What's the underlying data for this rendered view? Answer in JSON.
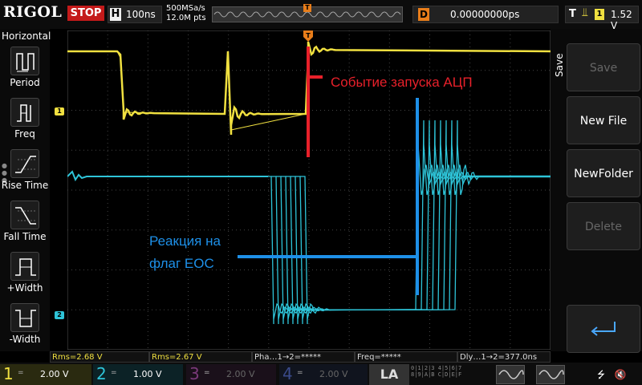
{
  "brand": "RIGOL",
  "run_state": "STOP",
  "horizontal": {
    "label": "H",
    "timebase": "100ns"
  },
  "sampling": {
    "rate": "500MSa/s",
    "points": "12.0M pts"
  },
  "trigger_pos_marker": "T",
  "delay": {
    "label": "D",
    "value": "0.00000000ps"
  },
  "trigger": {
    "label": "T",
    "slope_icon": "rising-edge-icon",
    "source": "1",
    "level": "1.52 V"
  },
  "left_menu": {
    "title": "Horizontal",
    "items": [
      {
        "label": "Period",
        "icon": "period-icon"
      },
      {
        "label": "Freq",
        "icon": "freq-icon"
      },
      {
        "label": "Rise Time",
        "icon": "rise-time-icon"
      },
      {
        "label": "Fall Time",
        "icon": "fall-time-icon"
      },
      {
        "label": "+Width",
        "icon": "pos-width-icon"
      },
      {
        "label": "-Width",
        "icon": "neg-width-icon"
      }
    ]
  },
  "channel_markers": {
    "ch1": "1",
    "ch2": "2"
  },
  "annotations": {
    "adc_trigger": "Событие запуска АЦП",
    "eoc_line1": "Реакция  на",
    "eoc_line2": "флаг EOC"
  },
  "right_menu": {
    "title": "Save",
    "buttons": [
      {
        "label": "Save",
        "enabled": false
      },
      {
        "label": "New File",
        "enabled": true
      },
      {
        "label": "NewFolder",
        "enabled": true
      },
      {
        "label": "Delete",
        "enabled": false
      },
      {
        "label": "",
        "icon": "return-icon",
        "enabled": true
      }
    ]
  },
  "measurements": [
    {
      "text": "Rms=2.68 V",
      "color": "#f0e040"
    },
    {
      "text": "Rms=2.67 V",
      "color": "#f0e040"
    },
    {
      "text": "Pha…1→2=*****",
      "color": "#dddddd"
    },
    {
      "text": "Freq=*****",
      "color": "#dddddd"
    },
    {
      "text": "Dly…1→2=377.0ns",
      "color": "#dddddd"
    }
  ],
  "channels": [
    {
      "num": "1",
      "coupling": "=",
      "scale": "2.00 V",
      "color": "#f0e040",
      "active": true
    },
    {
      "num": "2",
      "coupling": "=",
      "scale": "1.00 V",
      "color": "#2ec4d8",
      "active": true
    },
    {
      "num": "3",
      "coupling": "=",
      "scale": "2.00 V",
      "color": "#c040c0",
      "active": false
    },
    {
      "num": "4",
      "coupling": "=",
      "scale": "2.00 V",
      "color": "#4a6ad8",
      "active": false
    }
  ],
  "la": {
    "label": "LA",
    "bits_row1": "0|1|2|3  4|5|6|7",
    "bits_row2": "8|9|A|B  C|D|E|F"
  },
  "colors": {
    "ch1": "#f0e040",
    "ch2": "#2ec4d8",
    "annotation_red": "#e8202a",
    "annotation_blue": "#1e90e8",
    "stop": "#c41a1a",
    "trigger_orange": "#e87d1a"
  }
}
